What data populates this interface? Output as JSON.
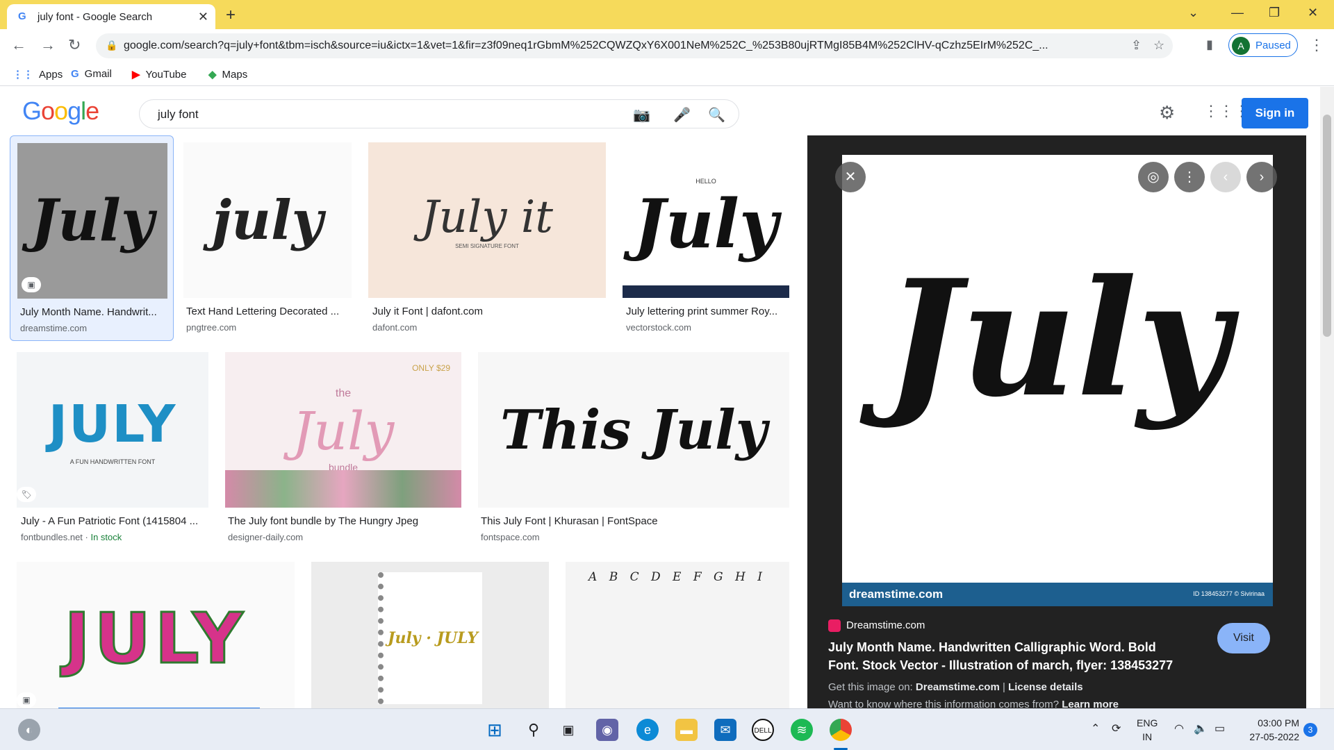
{
  "browser": {
    "tab_title": "july font - Google Search",
    "url": "google.com/search?q=july+font&tbm=isch&source=iu&ictx=1&vet=1&fir=z3f09neq1rGbmM%252CQWZQxY6X001NeM%252C_%253B80ujRTMgI85B4M%252ClHV-qCzhz5EIrM%252C_...",
    "profile_initial": "A",
    "profile_status": "Paused"
  },
  "bookmarks": [
    {
      "label": "Apps",
      "icon": "apps-grid-icon"
    },
    {
      "label": "Gmail",
      "icon": "google-icon"
    },
    {
      "label": "YouTube",
      "icon": "youtube-icon"
    },
    {
      "label": "Maps",
      "icon": "maps-icon"
    }
  ],
  "google": {
    "query": "july font",
    "sign_in": "Sign in"
  },
  "results": [
    {
      "word": "July",
      "caption": "July Month Name. Handwrit...",
      "source": "dreamstime.com"
    },
    {
      "word": "july",
      "caption": "Text Hand Lettering Decorated ...",
      "source": "pngtree.com"
    },
    {
      "word": "July it",
      "caption": "July it Font | dafont.com",
      "source": "dafont.com",
      "overlay": "SEMI SIGNATURE FONT"
    },
    {
      "word": "July",
      "caption": "July lettering print summer Roy...",
      "source": "vectorstock.com",
      "overlay": "HELLO"
    },
    {
      "word": "JULY",
      "caption": "July - A Fun Patriotic Font (1415804 ...",
      "source": "fontbundles.net",
      "stock": "In stock",
      "overlay": "A FUN HANDWRITTEN FONT"
    },
    {
      "word": "July",
      "caption": "The July font bundle by The Hungry Jpeg",
      "source": "designer-daily.com",
      "overlay_top": "the",
      "overlay_bottom": "bundle",
      "overlay_corner": "ONLY $29"
    },
    {
      "word": "This July",
      "caption": "This July Font | Khurasan | FontSpace",
      "source": "fontspace.com"
    },
    {
      "word": "JULY",
      "caption": "",
      "source": ""
    },
    {
      "word": "July · JULY",
      "caption": "",
      "source": ""
    },
    {
      "word": "A B C D E F G H I",
      "caption": "",
      "source": ""
    }
  ],
  "preview": {
    "word": "July",
    "watermark": "dreamstime.com",
    "image_id": "ID 138453277 © Sivirinaa",
    "site": "Dreamstime.com",
    "title": "July Month Name. Handwritten Calligraphic Word. Bold Font. Stock Vector - Illustration of march, flyer: 138453277",
    "visit": "Visit",
    "get_image_prefix": "Get this image on:",
    "get_image_site": "Dreamstime.com",
    "license": "License details",
    "why": "Want to know where this information comes from?",
    "learn_more": "Learn more"
  },
  "taskbar": {
    "lang_top": "ENG",
    "lang_bottom": "IN",
    "time": "03:00 PM",
    "date": "27-05-2022",
    "notifications": "3"
  }
}
